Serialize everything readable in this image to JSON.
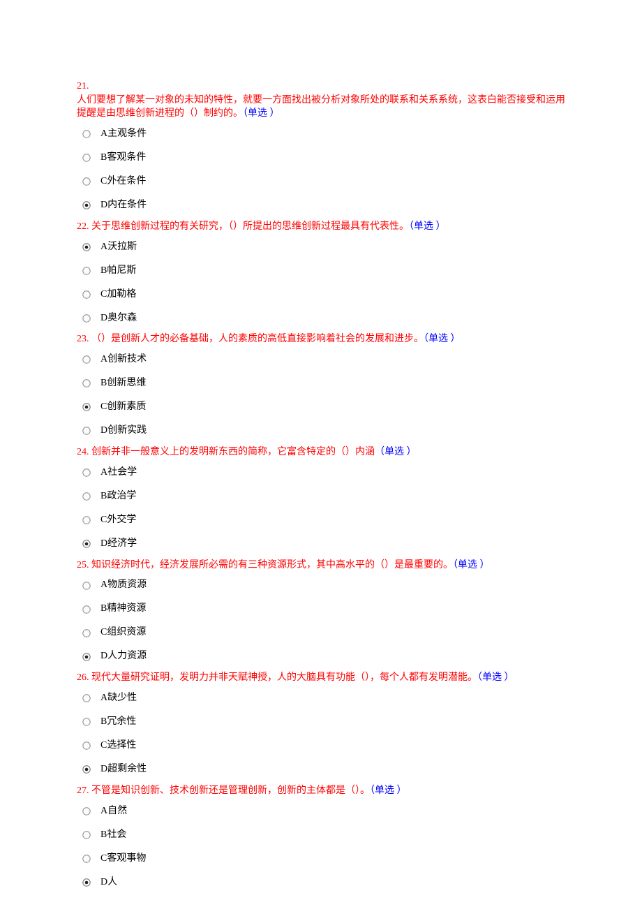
{
  "questions": [
    {
      "num": "21. ",
      "text_lines": [
        "人们要想了解某一对象的未知的特性，就要一方面找出被分析对象所处的联系和关系系统，这表白能否接受和运用提醒是由思维创新进程的（）制约的。"
      ],
      "tag": "（单选 ）",
      "options": [
        {
          "label": "A主观条件",
          "selected": false
        },
        {
          "label": "B客观条件",
          "selected": false
        },
        {
          "label": "C外在条件",
          "selected": false
        },
        {
          "label": "D内在条件",
          "selected": true
        }
      ]
    },
    {
      "num": "22. ",
      "text_lines": [
        "关于思维创新过程的有关研究，（）所提出的思维创新过程最具有代表性。"
      ],
      "tag": "（单选 ）",
      "options": [
        {
          "label": "A沃拉斯",
          "selected": true
        },
        {
          "label": "B帕尼斯",
          "selected": false
        },
        {
          "label": "C加勒格",
          "selected": false
        },
        {
          "label": "D奥尔森",
          "selected": false
        }
      ]
    },
    {
      "num": "23. ",
      "text_lines": [
        "（）是创新人才的必备基础，人的素质的高低直接影响着社会的发展和进步。"
      ],
      "tag": "（单选 ）",
      "options": [
        {
          "label": "A创新技术",
          "selected": false
        },
        {
          "label": "B创新思维",
          "selected": false
        },
        {
          "label": "C创新素质",
          "selected": true
        },
        {
          "label": "D创新实践",
          "selected": false
        }
      ]
    },
    {
      "num": "24. ",
      "text_lines": [
        "创新并非一般意义上的发明新东西的简称，它富含特定的（）内涵"
      ],
      "tag": "（单选 ）",
      "options": [
        {
          "label": "A社会学",
          "selected": false
        },
        {
          "label": "B政治学",
          "selected": false
        },
        {
          "label": "C外交学",
          "selected": false
        },
        {
          "label": "D经济学",
          "selected": true
        }
      ]
    },
    {
      "num": "25. ",
      "text_lines": [
        "知识经济时代，经济发展所必需的有三种资源形式，其中高水平的（）是最重要的。"
      ],
      "tag": "（单选 ）",
      "options": [
        {
          "label": "A物质资源",
          "selected": false
        },
        {
          "label": "B精神资源",
          "selected": false
        },
        {
          "label": "C组织资源",
          "selected": false
        },
        {
          "label": "D人力资源",
          "selected": true
        }
      ]
    },
    {
      "num": "26. ",
      "text_lines": [
        "现代大量研究证明，发明力并非天赋神授，人的大脑具有功能（），每个人都有发明潜能。"
      ],
      "tag": "（单选 ）",
      "options": [
        {
          "label": "A缺少性",
          "selected": false
        },
        {
          "label": "B冗余性",
          "selected": false
        },
        {
          "label": "C选择性",
          "selected": false
        },
        {
          "label": "D超剩余性",
          "selected": true
        }
      ]
    },
    {
      "num": "27. ",
      "text_lines": [
        "不管是知识创新、技术创新还是管理创新，创新的主体都是（）。"
      ],
      "tag": "（单选 ）",
      "options": [
        {
          "label": "A自然",
          "selected": false
        },
        {
          "label": "B社会",
          "selected": false
        },
        {
          "label": "C客观事物",
          "selected": false
        },
        {
          "label": "D人",
          "selected": true
        }
      ]
    }
  ]
}
